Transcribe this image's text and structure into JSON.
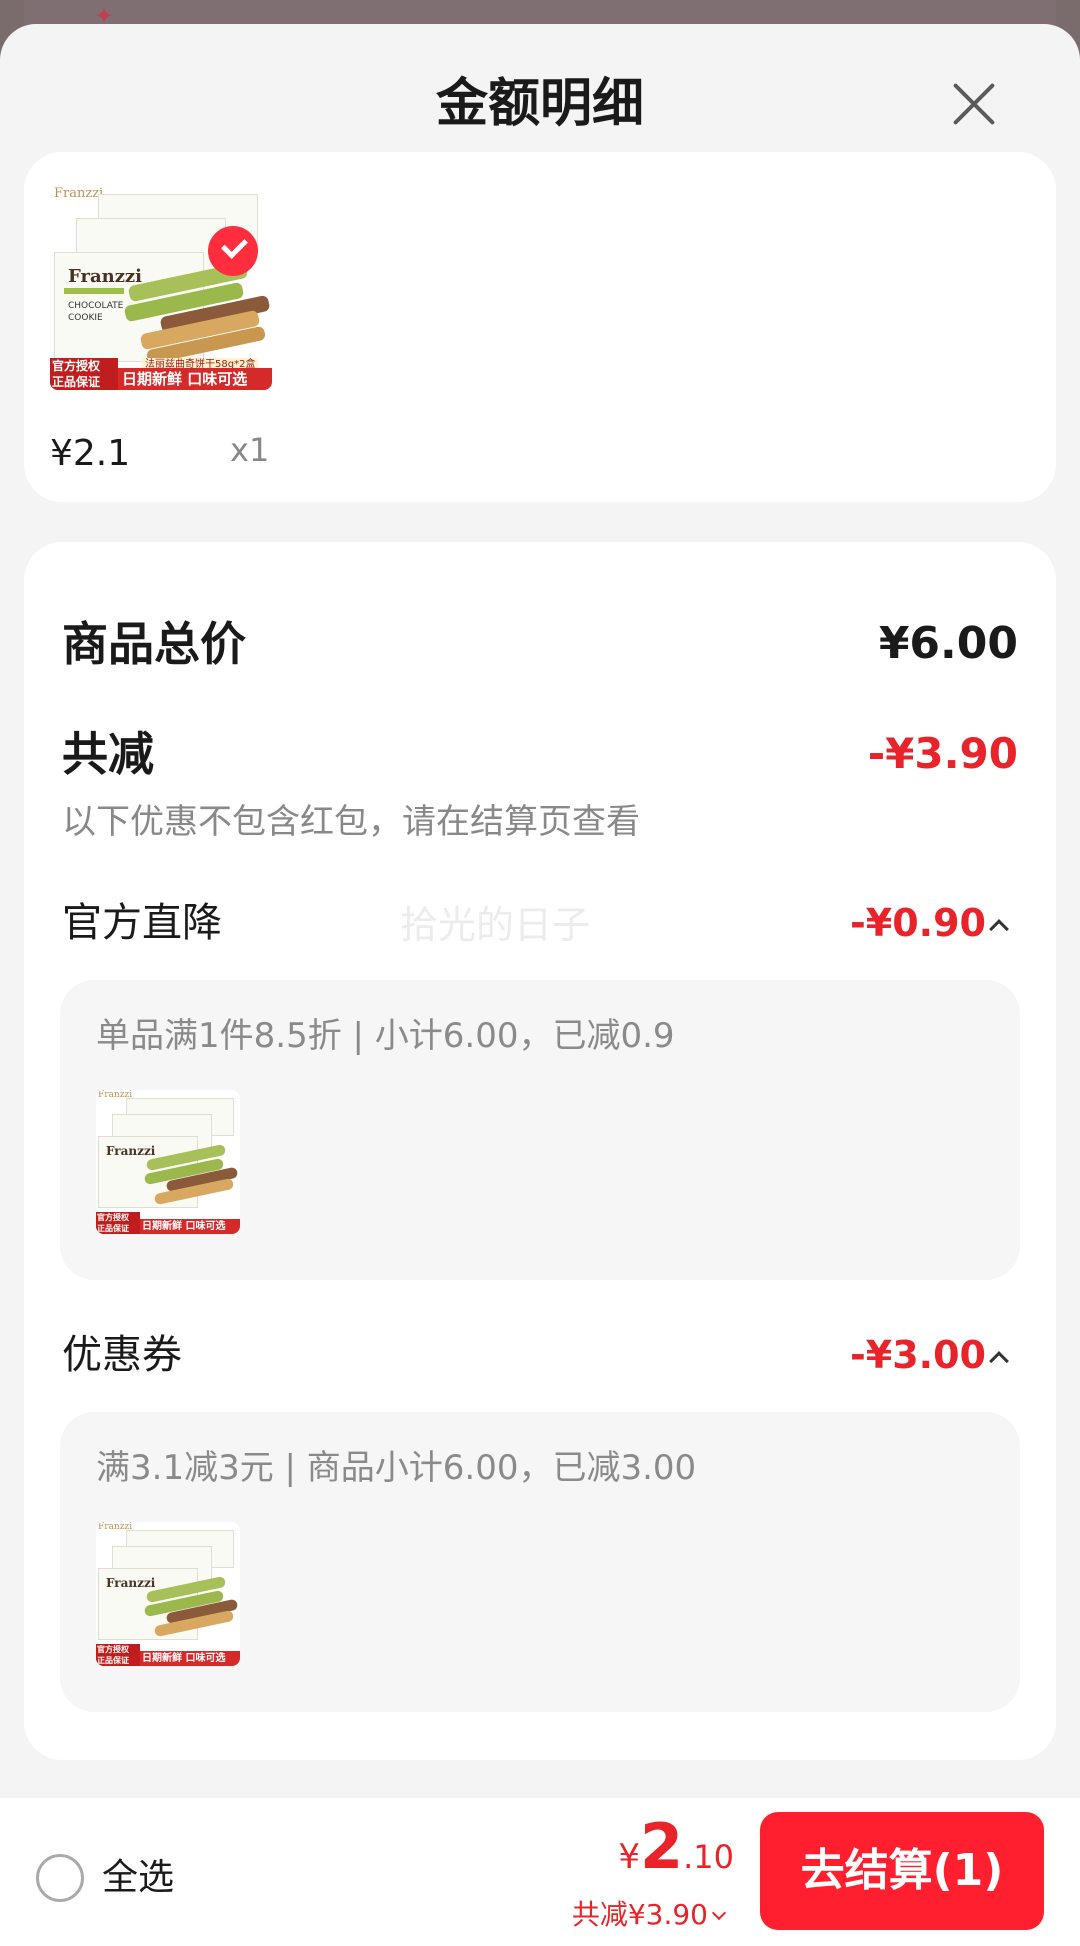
{
  "sheet": {
    "title": "金额明细"
  },
  "products": [
    {
      "price": "¥2.1",
      "quantity": "x1",
      "image": {
        "brand": "Franzzi",
        "package_text": "CHOCOLATE COOKIE",
        "tag": "法丽兹曲奇饼干58g*2盒",
        "banner_left": "官方授权 正品保证",
        "banner": "日期新鲜 口味可选"
      }
    }
  ],
  "summary": {
    "total_label": "商品总价",
    "total_value": "¥6.00",
    "discount_label": "共减",
    "discount_value": "-¥3.90",
    "discount_note": "以下优惠不包含红包，请在结算页查看",
    "watermark": "拾光的日子"
  },
  "sections": [
    {
      "label": "官方直降",
      "value": "-¥0.90",
      "detail": "单品满1件8.5折 | 小计6.00，已减0.9"
    },
    {
      "label": "优惠券",
      "value": "-¥3.00",
      "detail": "满3.1减3元 | 商品小计6.00，已减3.00"
    }
  ],
  "bottom_bar": {
    "select_all_label": "全选",
    "currency_symbol": "¥",
    "price_integer": "2",
    "price_decimal": ".10",
    "discount_text": "共减¥3.90",
    "checkout_label": "去结算(1)"
  },
  "colors": {
    "accent_red": "#e8232a",
    "checkout_button": "#ff1f2e",
    "sheet_background": "#f4f4f4"
  },
  "icons": {
    "close": "close-icon",
    "selected": "checkmark-icon",
    "collapse": "chevron-up-icon",
    "expand": "chevron-down-icon"
  }
}
